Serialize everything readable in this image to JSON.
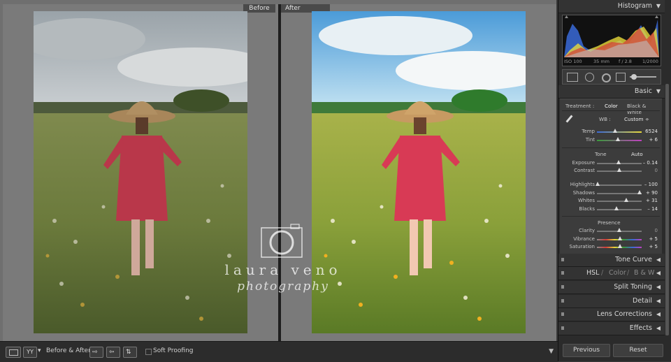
{
  "panes": {
    "before_label": "Before",
    "after_label": "After"
  },
  "watermark": {
    "line1": "laura veno",
    "line2": "photography"
  },
  "toolbar": {
    "yy_label": "YY",
    "before_after_label": "Before & After :",
    "soft_proofing_label": "Soft Proofing"
  },
  "panel": {
    "histogram_title": "Histogram",
    "histogram_info": [
      "ISO 100",
      "35 mm",
      "f / 2.8",
      "1/2000"
    ],
    "basic_title": "Basic",
    "treatment_label": "Treatment :",
    "treatment_color": "Color",
    "treatment_bw": "Black & White",
    "wb_label": "WB :",
    "wb_value": "Custom ÷",
    "temp": {
      "label": "Temp",
      "value": "6524",
      "pos": 0.45
    },
    "tint": {
      "label": "Tint",
      "value": "+ 6",
      "pos": 0.52
    },
    "tone_label": "Tone",
    "auto_label": "Auto",
    "exposure": {
      "label": "Exposure",
      "value": "– 0.14",
      "pos": 0.48
    },
    "contrast": {
      "label": "Contrast",
      "value": "0",
      "pos": 0.5
    },
    "highlights": {
      "label": "Highlights",
      "value": "– 100",
      "pos": 0.0
    },
    "shadows": {
      "label": "Shadows",
      "value": "+ 90",
      "pos": 0.95
    },
    "whites": {
      "label": "Whites",
      "value": "+ 31",
      "pos": 0.65
    },
    "blacks": {
      "label": "Blacks",
      "value": "– 14",
      "pos": 0.43
    },
    "presence_label": "Presence",
    "clarity": {
      "label": "Clarity",
      "value": "0",
      "pos": 0.5
    },
    "vibrance": {
      "label": "Vibrance",
      "value": "+ 5",
      "pos": 0.52
    },
    "saturation": {
      "label": "Saturation",
      "value": "+ 5",
      "pos": 0.52
    },
    "tone_curve_title": "Tone Curve",
    "hsl_title": "HSL",
    "hsl_color": "Color",
    "hsl_bw": "B & W",
    "split_toning_title": "Split Toning",
    "detail_title": "Detail",
    "lens_corrections_title": "Lens Corrections",
    "effects_title": "Effects",
    "previous_button": "Previous",
    "reset_button": "Reset"
  }
}
